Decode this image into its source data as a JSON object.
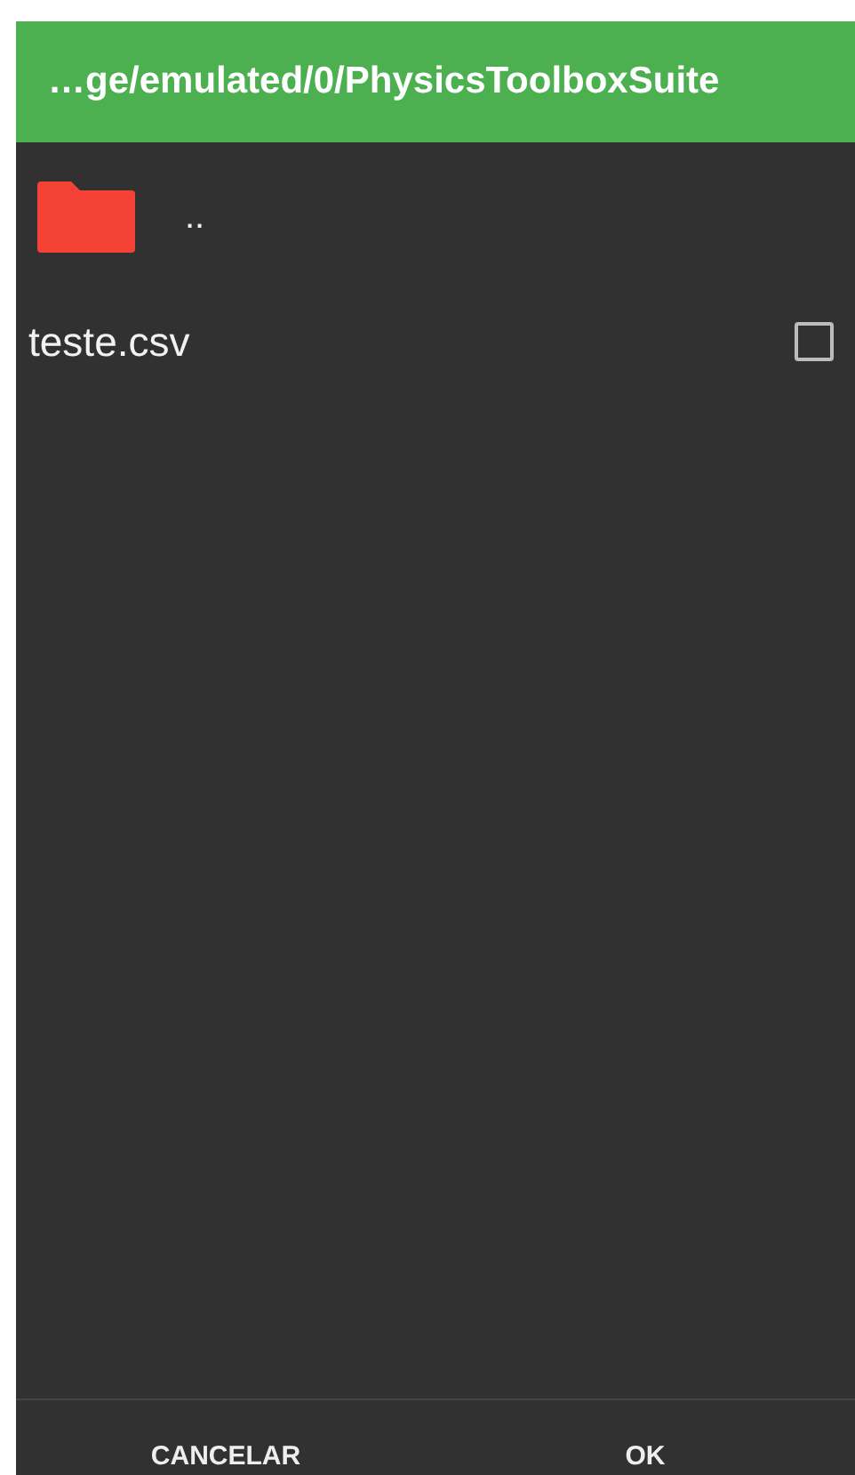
{
  "header": {
    "path": "…ge/emulated/0/PhysicsToolboxSuite"
  },
  "entries": [
    {
      "kind": "folder",
      "name": ".."
    },
    {
      "kind": "file",
      "name": "teste.csv",
      "checked": false
    }
  ],
  "buttons": [
    {
      "label": "CANCELAR"
    },
    {
      "label": "OK"
    }
  ]
}
